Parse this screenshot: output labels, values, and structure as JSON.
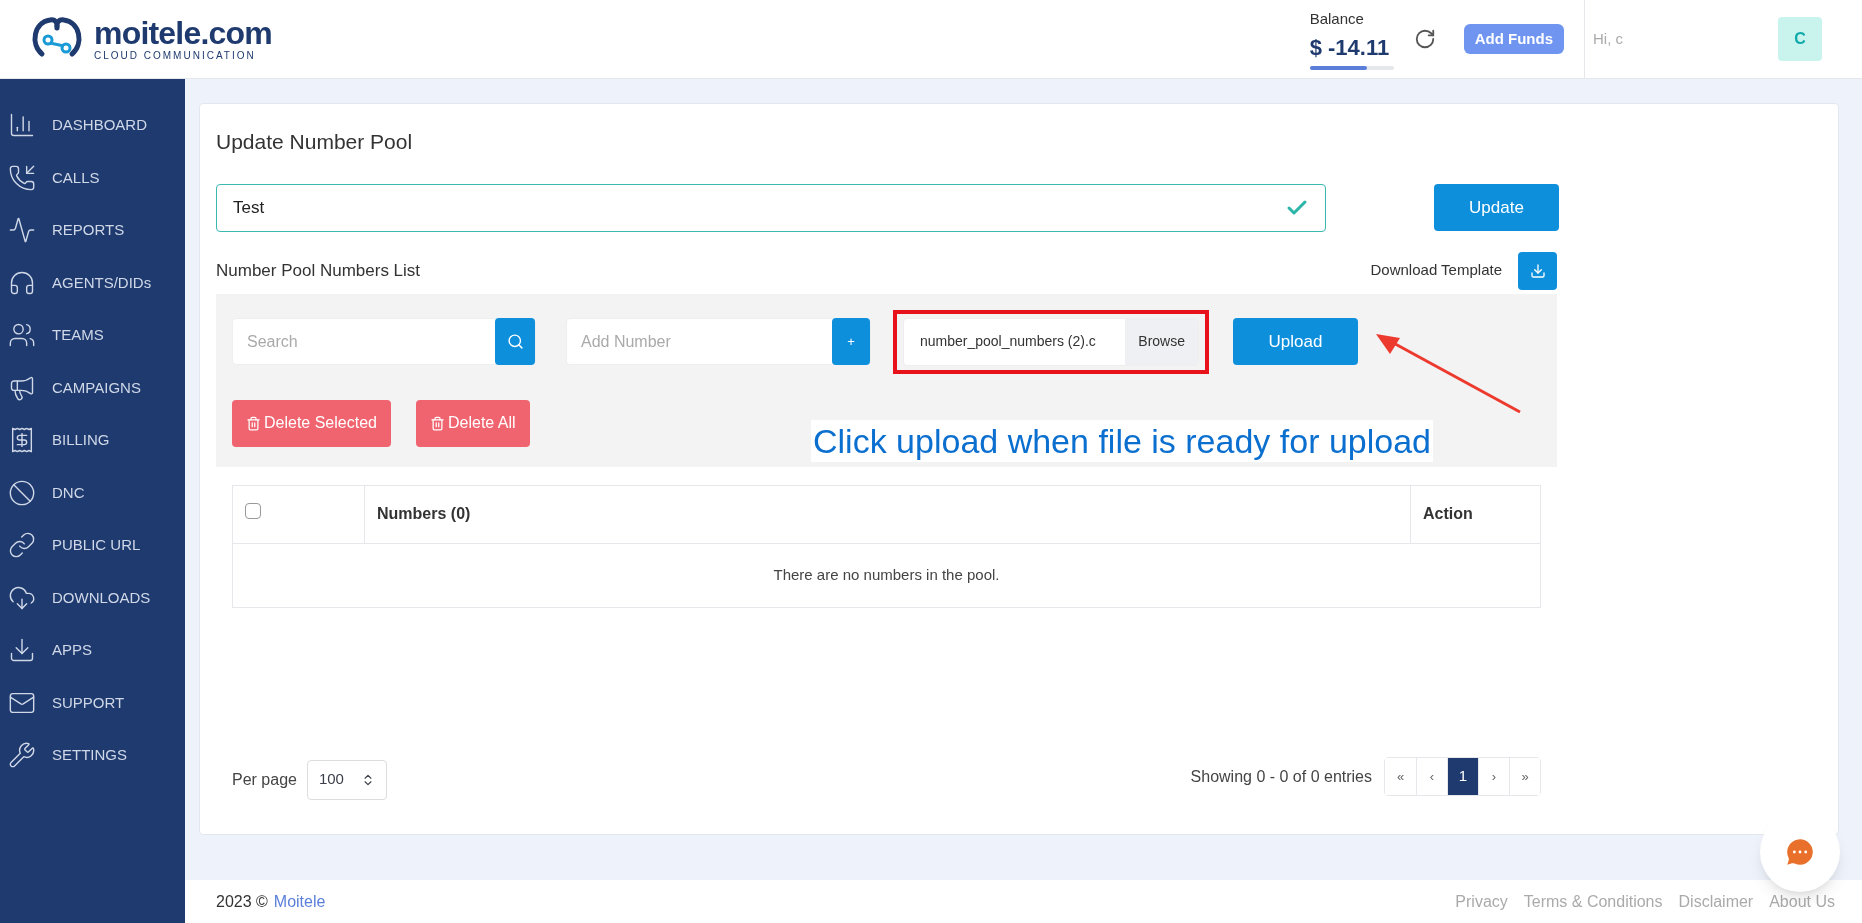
{
  "header": {
    "logo_name": "moitele.com",
    "logo_tagline": "CLOUD COMMUNICATION",
    "balance_label": "Balance",
    "balance_amount": "$ -14.11",
    "balance": {
      "level": 0.68
    },
    "add_funds": "Add Funds",
    "greeting": "Hi, c",
    "avatar": "C"
  },
  "sidebar": {
    "items": [
      {
        "label": "DASHBOARD",
        "selected": false
      },
      {
        "label": "CALLS",
        "selected": false
      },
      {
        "label": "REPORTS",
        "selected": false
      },
      {
        "label": "AGENTS/DIDs",
        "selected": false
      },
      {
        "label": "TEAMS",
        "selected": false
      },
      {
        "label": "CAMPAIGNS",
        "selected": false
      },
      {
        "label": "BILLING",
        "selected": false
      },
      {
        "label": "DNC",
        "selected": false
      },
      {
        "label": "PUBLIC URL",
        "selected": false
      },
      {
        "label": "DOWNLOADS",
        "selected": false
      },
      {
        "label": "APPS",
        "selected": false
      },
      {
        "label": "SUPPORT",
        "selected": false
      },
      {
        "label": "SETTINGS",
        "selected": false
      }
    ]
  },
  "page_title": "Update Number Pool",
  "pool_name": {
    "value": "Test",
    "valid": true
  },
  "update_button": "Update",
  "list_title": "Number Pool Numbers List",
  "download_template": "Download Template",
  "search": {
    "placeholder": "Search"
  },
  "add_number": {
    "placeholder": "Add Number",
    "button": "+"
  },
  "file": {
    "name": "number_pool_numbers (2).c",
    "browse": "Browse",
    "highlighted": true
  },
  "upload_button": "Upload",
  "delete_selected": "Delete Selected",
  "delete_all": "Delete All",
  "annotation": "Click upload when file is ready for upload",
  "table": {
    "select_all": {
      "checked": false
    },
    "columns": [
      "Numbers (0)",
      "Action"
    ],
    "empty_message": "There are no numbers in the pool."
  },
  "per_page": {
    "label": "Per page",
    "value": "100"
  },
  "showing": "Showing 0 - 0 of 0 entries",
  "pagination": [
    {
      "label": "«",
      "selected": false
    },
    {
      "label": "‹",
      "selected": false
    },
    {
      "label": "1",
      "selected": true
    },
    {
      "label": "›",
      "selected": false
    },
    {
      "label": "»",
      "selected": false
    }
  ],
  "footer": {
    "year": "2023 ©",
    "brand": "Moitele",
    "links": [
      "Privacy",
      "Terms & Conditions",
      "Disclaimer",
      "About Us"
    ]
  }
}
